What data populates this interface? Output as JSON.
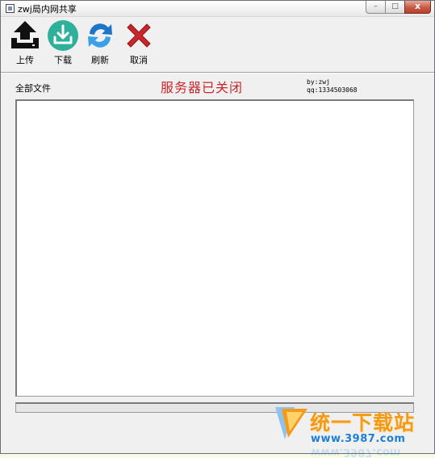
{
  "window": {
    "title": "zwj局内网共享"
  },
  "titlebar_buttons": {
    "minimize": "–",
    "maximize": "□",
    "close": "x"
  },
  "toolbar": {
    "upload_label": "上传",
    "download_label": "下载",
    "refresh_label": "刷新",
    "cancel_label": "取消"
  },
  "header": {
    "all_files_label": "全部文件",
    "server_status": "服务器已关闭",
    "author_by": "by:zwj",
    "author_qq": "qq:1334503068"
  },
  "file_list": {
    "items": []
  },
  "progress": {
    "value": 0
  },
  "watermark": {
    "site_name": "统一下载站",
    "url": "www.3987.com"
  },
  "colors": {
    "status_red": "#c8262a",
    "download_green": "#2fb09a",
    "refresh_blue": "#1d74c8",
    "cancel_red": "#c8282b"
  },
  "icons": {
    "upload": "upload-icon",
    "download": "download-icon",
    "refresh": "refresh-icon",
    "cancel": "cancel-icon"
  }
}
